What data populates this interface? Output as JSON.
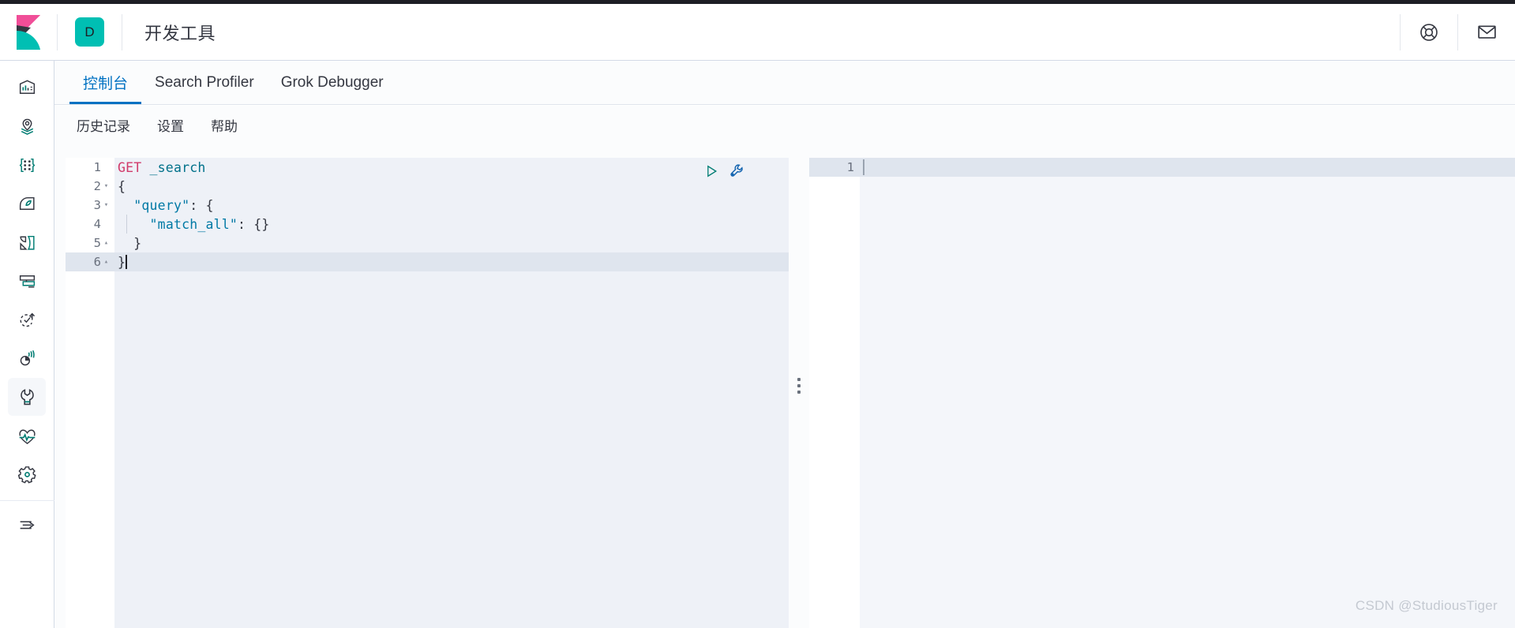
{
  "header": {
    "logo_icon": "kibana-logo",
    "space_badge": "D",
    "app_title": "开发工具",
    "help_icon": "life-ring-icon",
    "news_icon": "envelope-icon"
  },
  "sidebar": {
    "items": [
      {
        "icon": "dashboard-icon",
        "name": "dashboard",
        "active": false
      },
      {
        "icon": "maps-pin-layers-icon",
        "name": "maps",
        "active": false
      },
      {
        "icon": "machine-learning-dots-icon",
        "name": "machine-learning",
        "active": false
      },
      {
        "icon": "graph-icon",
        "name": "graph",
        "active": false
      },
      {
        "icon": "visualize-shapes-icon",
        "name": "visualize",
        "active": false
      },
      {
        "icon": "monitor-screen-icon",
        "name": "monitoring",
        "active": false
      },
      {
        "icon": "rollup-clock-arrow-icon",
        "name": "rollup-jobs",
        "active": false
      },
      {
        "icon": "apm-signal-icon",
        "name": "apm",
        "active": false
      },
      {
        "icon": "wrench-icon",
        "name": "dev-tools",
        "active": true
      },
      {
        "icon": "heartbeat-icon",
        "name": "uptime",
        "active": false
      },
      {
        "icon": "gear-icon",
        "name": "management",
        "active": false
      }
    ],
    "collapse_icon": "collapse-arrow-icon"
  },
  "tabs": [
    {
      "label": "控制台",
      "active": true
    },
    {
      "label": "Search Profiler",
      "active": false
    },
    {
      "label": "Grok Debugger",
      "active": false
    }
  ],
  "subnav": [
    {
      "label": "历史记录"
    },
    {
      "label": "设置"
    },
    {
      "label": "帮助"
    }
  ],
  "editor": {
    "play_icon": "play-triangle-icon",
    "wrench_icon": "wrench-settings-icon",
    "lines": [
      {
        "num": "1",
        "fold": "",
        "highlight": false
      },
      {
        "num": "2",
        "fold": "▾",
        "highlight": false
      },
      {
        "num": "3",
        "fold": "▾",
        "highlight": false
      },
      {
        "num": "4",
        "fold": "",
        "highlight": false
      },
      {
        "num": "5",
        "fold": "▴",
        "highlight": false
      },
      {
        "num": "6",
        "fold": "▴",
        "highlight": true
      }
    ],
    "code": {
      "l1_method": "GET",
      "l1_url": " _search",
      "l2": "{",
      "l3_key": "\"query\"",
      "l3_rest": ": {",
      "l4_key": "\"match_all\"",
      "l4_rest": ": {}",
      "l5": "}",
      "l6": "}"
    }
  },
  "response": {
    "line_number": "1",
    "content": ""
  },
  "watermark": "CSDN @StudiousTiger",
  "colors": {
    "accent_blue": "#0071c2",
    "teal": "#00bfb3",
    "pink": "#f04e98",
    "dark": "#1d1e24",
    "editor_bg": "#eef1f7",
    "highlight": "#dfe5ee"
  }
}
